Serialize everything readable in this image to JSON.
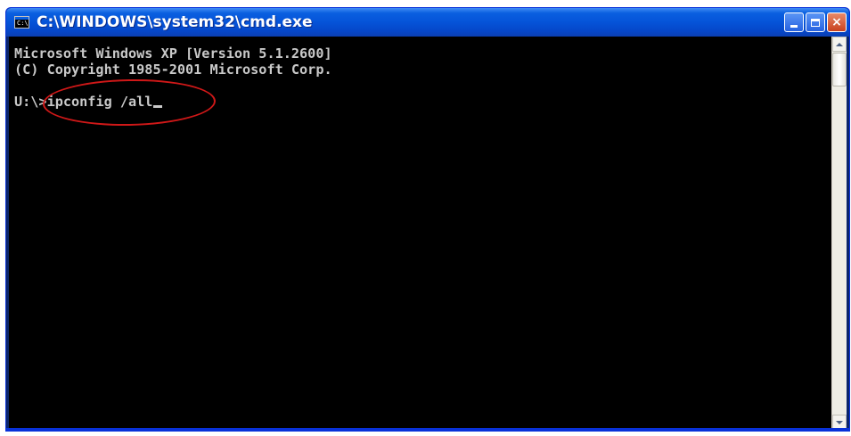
{
  "window": {
    "title": "C:\\WINDOWS\\system32\\cmd.exe",
    "app_icon": "cmd-icon",
    "controls": {
      "minimize_icon": "minimize-icon",
      "maximize_icon": "maximize-icon",
      "close_icon": "close-icon",
      "close_glyph": "×"
    }
  },
  "console": {
    "lines": [
      "Microsoft Windows XP [Version 5.1.2600]",
      "(C) Copyright 1985-2001 Microsoft Corp.",
      ""
    ],
    "prompt": "U:\\>",
    "command": "ipconfig /all",
    "background": "#000000",
    "foreground": "#c0c0c0"
  },
  "annotation": {
    "shape": "ellipse",
    "color": "#d01818",
    "target": "command"
  },
  "colors": {
    "titlebar": "#0553d8",
    "close_button": "#c8421e"
  }
}
